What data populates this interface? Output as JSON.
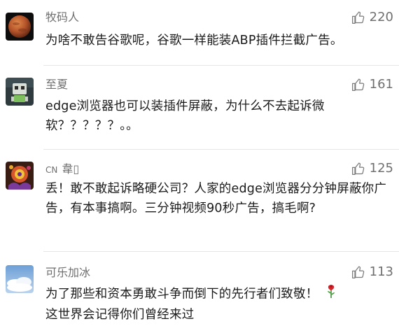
{
  "comments": [
    {
      "username": "牧码人",
      "likes": "220",
      "text": "为啥不敢告谷歌呢，谷歌一样能装ABP插件拦截广告。",
      "avatar": "mars-planet-avatar"
    },
    {
      "username": "至夏",
      "likes": "161",
      "text": "edge浏览器也可以装插件屏蔽，为什么不去起诉微软？？？？？。。",
      "avatar": "robot-cartoon-avatar"
    },
    {
      "username_prefix": "CN",
      "username": "韋▯",
      "likes": "125",
      "text": "丢！敢不敢起诉略硬公司？人家的edge浏览器分分钟屏蔽你广告，有本事搞啊。三分钟视频90秒广告，搞毛啊?",
      "avatar": "colorful-art-avatar"
    },
    {
      "username": "可乐加冰",
      "likes": "113",
      "text": "为了那些和资本勇敢斗争而倒下的先行者们致敬！",
      "text_line2": "这世界会记得你们曾经来过",
      "emoji": "rose-icon",
      "avatar": "sky-clouds-avatar"
    }
  ],
  "colors": {
    "meta": "#6f6f6f",
    "text": "#1a1a1a",
    "divider": "#e6e6e6"
  }
}
